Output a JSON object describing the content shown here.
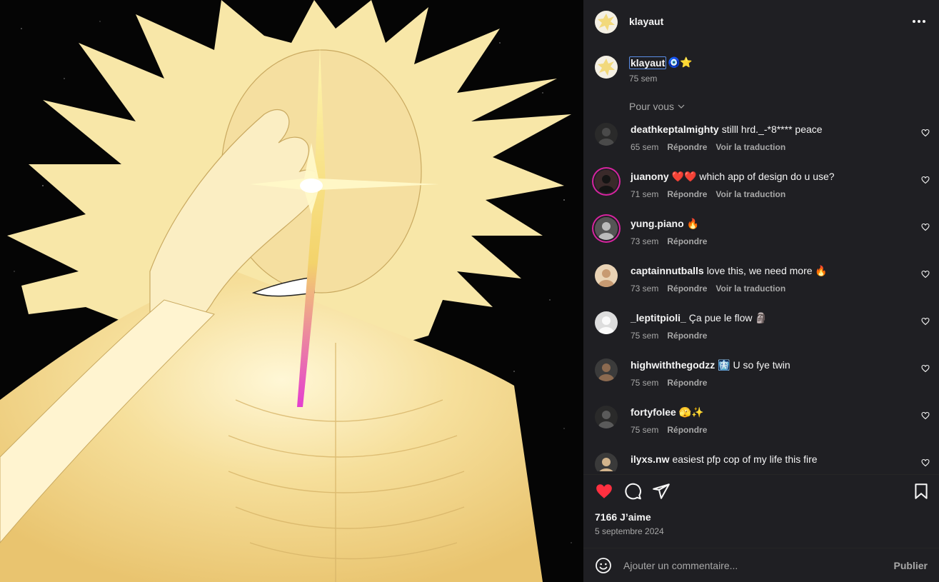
{
  "post": {
    "author": "klayaut",
    "caption_user": "klayaut",
    "caption_emoji": "🧿⭐",
    "caption_time": "75 sem",
    "sort_label": "Pour vous",
    "likes": "7166 J’aime",
    "date": "5 septembre 2024"
  },
  "comments": [
    {
      "user": "deathkeptalmighty",
      "text": "stilll hrd._-*8**** peace",
      "time": "65 sem",
      "reply": "Répondre",
      "translate": "Voir la traduction"
    },
    {
      "user": "juanony",
      "text": "❤️❤️ which app of design do u use?",
      "time": "71 sem",
      "reply": "Répondre",
      "translate": "Voir la traduction"
    },
    {
      "user": "yung.piano",
      "text": "🔥",
      "time": "73 sem",
      "reply": "Répondre",
      "translate": ""
    },
    {
      "user": "captainnutballs",
      "text": "love this, we need more 🔥",
      "time": "73 sem",
      "reply": "Répondre",
      "translate": "Voir la traduction"
    },
    {
      "user": "_leptitpioli_",
      "text": "Ça pue le flow 🗿",
      "time": "75 sem",
      "reply": "Répondre",
      "translate": ""
    },
    {
      "user": "highwiththegodzz",
      "text": "🩻 U so fye twin",
      "time": "75 sem",
      "reply": "Répondre",
      "translate": ""
    },
    {
      "user": "fortyfolee",
      "text": "🫣✨",
      "time": "75 sem",
      "reply": "Répondre",
      "translate": ""
    },
    {
      "user": "ilyxs.nw",
      "text": "easiest pfp cop of my life this fire",
      "time": "",
      "reply": "",
      "translate": ""
    }
  ],
  "composer": {
    "placeholder": "Ajouter un commentaire...",
    "publish_label": "Publier"
  },
  "icons": {
    "like": "heart-filled-icon",
    "comment": "comment-bubble-icon",
    "share": "paper-plane-icon",
    "save": "bookmark-icon",
    "emoji": "smiley-icon",
    "more": "ellipsis-icon",
    "comment_like": "heart-outline-icon"
  },
  "colors": {
    "like_red": "#ff3040",
    "panel_bg": "#1f1f23",
    "text_secondary": "#a8a8a8",
    "art_glow": "#f7e6a6"
  }
}
